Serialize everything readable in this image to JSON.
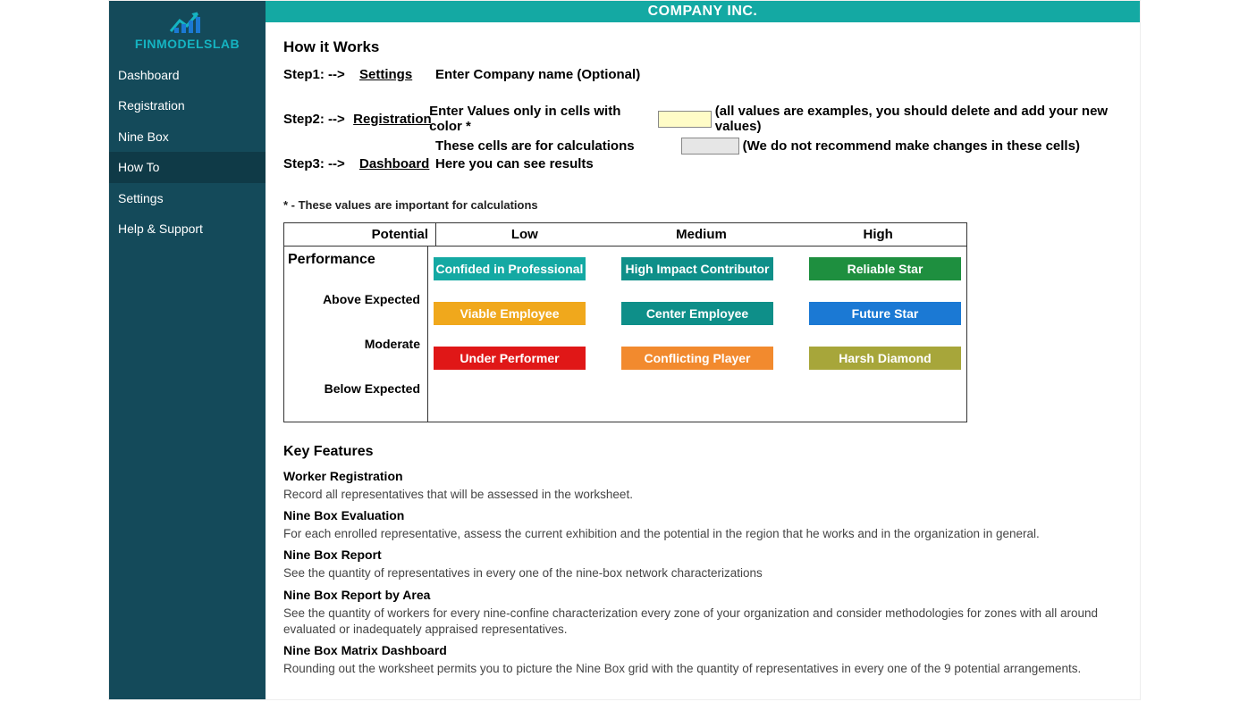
{
  "header": {
    "company": "COMPANY INC."
  },
  "logo": {
    "text": "FINMODELSLAB"
  },
  "sidebar": {
    "items": [
      {
        "label": "Dashboard"
      },
      {
        "label": "Registration"
      },
      {
        "label": "Nine Box"
      },
      {
        "label": "How To"
      },
      {
        "label": "Settings"
      },
      {
        "label": "Help & Support"
      }
    ],
    "active_index": 3
  },
  "howitworks": {
    "title": "How it Works",
    "steps": [
      {
        "label": "Step1: -->",
        "link": "Settings",
        "desc": "Enter Company name (Optional)"
      },
      {
        "label": "Step2: -->",
        "link": "Registration",
        "desc": "Enter Values only in cells with color *",
        "hint": "(all values are examples, you should delete and add your new values)"
      },
      {
        "label": "",
        "link": "",
        "desc": "These cells are for calculations",
        "hint": "(We do not recommend make changes in these cells)"
      },
      {
        "label": "Step3: -->",
        "link": "Dashboard",
        "desc": "Here you can see results"
      }
    ],
    "footnote": "* - These values are important for calculations"
  },
  "grid": {
    "potential_label": "Potential",
    "performance_label": "Performance",
    "cols": [
      "Low",
      "Medium",
      "High"
    ],
    "rows": [
      "Above Expected",
      "Moderate",
      "Below Expected"
    ],
    "cells": [
      [
        "Confided in Professional",
        "High Impact Contributor",
        "Reliable Star"
      ],
      [
        "Viable Employee",
        "Center Employee",
        "Future Star"
      ],
      [
        "Under Performer",
        "Conflicting Player",
        "Harsh Diamond"
      ]
    ]
  },
  "keyfeatures": {
    "title": "Key Features",
    "items": [
      {
        "h": "Worker Registration",
        "p": "Record all representatives that will be assessed in the worksheet."
      },
      {
        "h": "Nine Box Evaluation",
        "p": "For each enrolled representative, assess the current exhibition and the potential in the region that he works and in the organization in general."
      },
      {
        "h": "Nine Box Report",
        "p": "See the quantity of representatives in every one of the nine-box network characterizations"
      },
      {
        "h": "Nine Box Report by Area",
        "p": "See the quantity of workers for every nine-confine characterization every zone of your organization and consider methodologies for zones with all around evaluated or inadequately appraised representatives."
      },
      {
        "h": "Nine Box Matrix Dashboard",
        "p": "Rounding out the worksheet permits you to picture the Nine Box grid with the quantity of representatives in every one of the 9 potential arrangements."
      }
    ]
  },
  "chart_data": {
    "type": "table",
    "title": "Nine Box Matrix",
    "row_axis": "Performance",
    "col_axis": "Potential",
    "columns": [
      "Low",
      "Medium",
      "High"
    ],
    "rows": [
      "Above Expected",
      "Moderate",
      "Below Expected"
    ],
    "values": [
      [
        "Confided in Professional",
        "High Impact Contributor",
        "Reliable Star"
      ],
      [
        "Viable Employee",
        "Center Employee",
        "Future Star"
      ],
      [
        "Under Performer",
        "Conflicting Player",
        "Harsh Diamond"
      ]
    ]
  }
}
